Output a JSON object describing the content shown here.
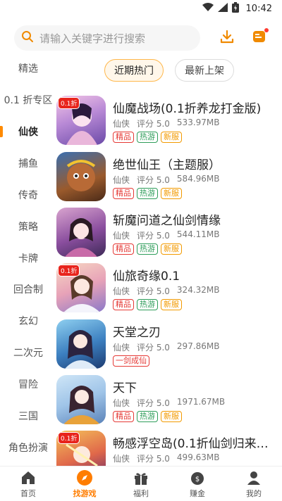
{
  "status": {
    "time": "10:42"
  },
  "search": {
    "placeholder": "请输入关键字进行搜索"
  },
  "colors": {
    "accent": "#ff8a00",
    "tag_jingpin": "#e53935",
    "tag_reyou": "#2e9d5a",
    "tag_xinfu": "#f29a00"
  },
  "sidebar": {
    "items": [
      {
        "label": "精选"
      },
      {
        "label": "0.1 折专区"
      },
      {
        "label": "仙侠"
      },
      {
        "label": "捕鱼"
      },
      {
        "label": "传奇"
      },
      {
        "label": "策略"
      },
      {
        "label": "卡牌"
      },
      {
        "label": "回合制"
      },
      {
        "label": "玄幻"
      },
      {
        "label": "二次元"
      },
      {
        "label": "冒险"
      },
      {
        "label": "三国"
      },
      {
        "label": "角色扮演"
      }
    ],
    "active": "仙侠"
  },
  "tabs": [
    {
      "label": "近期热门"
    },
    {
      "label": "最新上架"
    }
  ],
  "games": [
    {
      "title": "仙魔战场(0.1折养龙打金版)",
      "category": "仙侠",
      "rating": "评分 5.0",
      "size": "533.97MB",
      "tags": [
        "精品",
        "热游",
        "新服"
      ],
      "badge": "0.1折"
    },
    {
      "title": "绝世仙王（主题服）",
      "category": "仙侠",
      "rating": "评分 5.0",
      "size": "584.96MB",
      "tags": [
        "精品",
        "热游",
        "新服"
      ],
      "badge": ""
    },
    {
      "title": "斩魔问道之仙剑情缘",
      "category": "仙侠",
      "rating": "评分 5.0",
      "size": "544.11MB",
      "tags": [
        "精品",
        "热游",
        "新服"
      ],
      "badge": ""
    },
    {
      "title": "仙旅奇缘0.1",
      "category": "仙侠",
      "rating": "评分 5.0",
      "size": "324.32MB",
      "tags": [
        "精品",
        "热游",
        "新服"
      ],
      "badge": "0.1折"
    },
    {
      "title": "天堂之刃",
      "category": "仙侠",
      "rating": "评分 5.0",
      "size": "297.86MB",
      "tags": [
        "一剑成仙"
      ],
      "badge": ""
    },
    {
      "title": "天下",
      "category": "仙侠",
      "rating": "评分 5.0",
      "size": "1971.67MB",
      "tags": [
        "精品",
        "热游",
        "新服"
      ],
      "badge": ""
    },
    {
      "title": "畅感浮空岛(0.1折仙剑归来送…",
      "category": "仙侠",
      "rating": "评分 5.0",
      "size": "499.63MB",
      "tags": [],
      "badge": "0.1折"
    }
  ],
  "nav": [
    {
      "label": "首页"
    },
    {
      "label": "找游戏"
    },
    {
      "label": "福利"
    },
    {
      "label": "赚金"
    },
    {
      "label": "我的"
    }
  ]
}
